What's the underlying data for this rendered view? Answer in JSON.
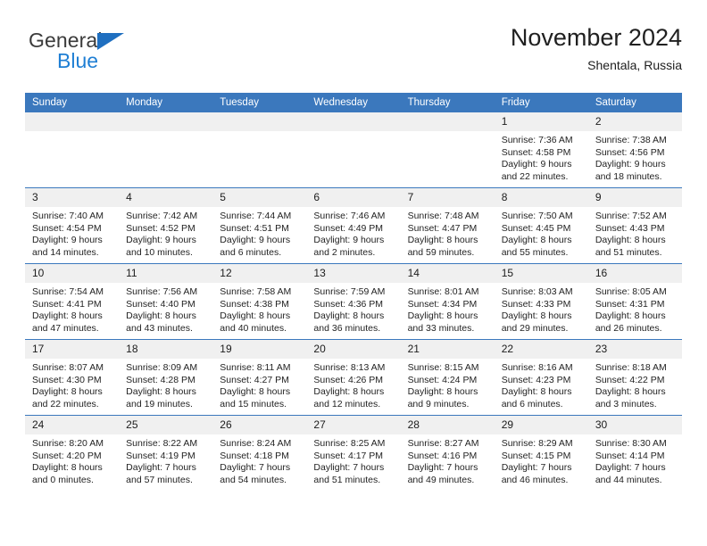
{
  "brand": {
    "name_top": "General",
    "name_bottom": "Blue",
    "triangle_color": "#1f6fc0",
    "blue_text_color": "#1f7fd4"
  },
  "header": {
    "title": "November 2024",
    "subtitle": "Shentala, Russia"
  },
  "theme": {
    "header_blue": "#3b78bd",
    "daynum_band": "#f0f0f0",
    "text": "#232323"
  },
  "weekday_headers": [
    "Sunday",
    "Monday",
    "Tuesday",
    "Wednesday",
    "Thursday",
    "Friday",
    "Saturday"
  ],
  "weeks": [
    [
      {
        "day": "",
        "empty": true,
        "sunrise": "",
        "sunset": "",
        "daylight_line1": "",
        "daylight_line2": ""
      },
      {
        "day": "",
        "empty": true,
        "sunrise": "",
        "sunset": "",
        "daylight_line1": "",
        "daylight_line2": ""
      },
      {
        "day": "",
        "empty": true,
        "sunrise": "",
        "sunset": "",
        "daylight_line1": "",
        "daylight_line2": ""
      },
      {
        "day": "",
        "empty": true,
        "sunrise": "",
        "sunset": "",
        "daylight_line1": "",
        "daylight_line2": ""
      },
      {
        "day": "",
        "empty": true,
        "sunrise": "",
        "sunset": "",
        "daylight_line1": "",
        "daylight_line2": ""
      },
      {
        "day": "1",
        "empty": false,
        "sunrise": "Sunrise: 7:36 AM",
        "sunset": "Sunset: 4:58 PM",
        "daylight_line1": "Daylight: 9 hours",
        "daylight_line2": "and 22 minutes."
      },
      {
        "day": "2",
        "empty": false,
        "sunrise": "Sunrise: 7:38 AM",
        "sunset": "Sunset: 4:56 PM",
        "daylight_line1": "Daylight: 9 hours",
        "daylight_line2": "and 18 minutes."
      }
    ],
    [
      {
        "day": "3",
        "empty": false,
        "sunrise": "Sunrise: 7:40 AM",
        "sunset": "Sunset: 4:54 PM",
        "daylight_line1": "Daylight: 9 hours",
        "daylight_line2": "and 14 minutes."
      },
      {
        "day": "4",
        "empty": false,
        "sunrise": "Sunrise: 7:42 AM",
        "sunset": "Sunset: 4:52 PM",
        "daylight_line1": "Daylight: 9 hours",
        "daylight_line2": "and 10 minutes."
      },
      {
        "day": "5",
        "empty": false,
        "sunrise": "Sunrise: 7:44 AM",
        "sunset": "Sunset: 4:51 PM",
        "daylight_line1": "Daylight: 9 hours",
        "daylight_line2": "and 6 minutes."
      },
      {
        "day": "6",
        "empty": false,
        "sunrise": "Sunrise: 7:46 AM",
        "sunset": "Sunset: 4:49 PM",
        "daylight_line1": "Daylight: 9 hours",
        "daylight_line2": "and 2 minutes."
      },
      {
        "day": "7",
        "empty": false,
        "sunrise": "Sunrise: 7:48 AM",
        "sunset": "Sunset: 4:47 PM",
        "daylight_line1": "Daylight: 8 hours",
        "daylight_line2": "and 59 minutes."
      },
      {
        "day": "8",
        "empty": false,
        "sunrise": "Sunrise: 7:50 AM",
        "sunset": "Sunset: 4:45 PM",
        "daylight_line1": "Daylight: 8 hours",
        "daylight_line2": "and 55 minutes."
      },
      {
        "day": "9",
        "empty": false,
        "sunrise": "Sunrise: 7:52 AM",
        "sunset": "Sunset: 4:43 PM",
        "daylight_line1": "Daylight: 8 hours",
        "daylight_line2": "and 51 minutes."
      }
    ],
    [
      {
        "day": "10",
        "empty": false,
        "sunrise": "Sunrise: 7:54 AM",
        "sunset": "Sunset: 4:41 PM",
        "daylight_line1": "Daylight: 8 hours",
        "daylight_line2": "and 47 minutes."
      },
      {
        "day": "11",
        "empty": false,
        "sunrise": "Sunrise: 7:56 AM",
        "sunset": "Sunset: 4:40 PM",
        "daylight_line1": "Daylight: 8 hours",
        "daylight_line2": "and 43 minutes."
      },
      {
        "day": "12",
        "empty": false,
        "sunrise": "Sunrise: 7:58 AM",
        "sunset": "Sunset: 4:38 PM",
        "daylight_line1": "Daylight: 8 hours",
        "daylight_line2": "and 40 minutes."
      },
      {
        "day": "13",
        "empty": false,
        "sunrise": "Sunrise: 7:59 AM",
        "sunset": "Sunset: 4:36 PM",
        "daylight_line1": "Daylight: 8 hours",
        "daylight_line2": "and 36 minutes."
      },
      {
        "day": "14",
        "empty": false,
        "sunrise": "Sunrise: 8:01 AM",
        "sunset": "Sunset: 4:34 PM",
        "daylight_line1": "Daylight: 8 hours",
        "daylight_line2": "and 33 minutes."
      },
      {
        "day": "15",
        "empty": false,
        "sunrise": "Sunrise: 8:03 AM",
        "sunset": "Sunset: 4:33 PM",
        "daylight_line1": "Daylight: 8 hours",
        "daylight_line2": "and 29 minutes."
      },
      {
        "day": "16",
        "empty": false,
        "sunrise": "Sunrise: 8:05 AM",
        "sunset": "Sunset: 4:31 PM",
        "daylight_line1": "Daylight: 8 hours",
        "daylight_line2": "and 26 minutes."
      }
    ],
    [
      {
        "day": "17",
        "empty": false,
        "sunrise": "Sunrise: 8:07 AM",
        "sunset": "Sunset: 4:30 PM",
        "daylight_line1": "Daylight: 8 hours",
        "daylight_line2": "and 22 minutes."
      },
      {
        "day": "18",
        "empty": false,
        "sunrise": "Sunrise: 8:09 AM",
        "sunset": "Sunset: 4:28 PM",
        "daylight_line1": "Daylight: 8 hours",
        "daylight_line2": "and 19 minutes."
      },
      {
        "day": "19",
        "empty": false,
        "sunrise": "Sunrise: 8:11 AM",
        "sunset": "Sunset: 4:27 PM",
        "daylight_line1": "Daylight: 8 hours",
        "daylight_line2": "and 15 minutes."
      },
      {
        "day": "20",
        "empty": false,
        "sunrise": "Sunrise: 8:13 AM",
        "sunset": "Sunset: 4:26 PM",
        "daylight_line1": "Daylight: 8 hours",
        "daylight_line2": "and 12 minutes."
      },
      {
        "day": "21",
        "empty": false,
        "sunrise": "Sunrise: 8:15 AM",
        "sunset": "Sunset: 4:24 PM",
        "daylight_line1": "Daylight: 8 hours",
        "daylight_line2": "and 9 minutes."
      },
      {
        "day": "22",
        "empty": false,
        "sunrise": "Sunrise: 8:16 AM",
        "sunset": "Sunset: 4:23 PM",
        "daylight_line1": "Daylight: 8 hours",
        "daylight_line2": "and 6 minutes."
      },
      {
        "day": "23",
        "empty": false,
        "sunrise": "Sunrise: 8:18 AM",
        "sunset": "Sunset: 4:22 PM",
        "daylight_line1": "Daylight: 8 hours",
        "daylight_line2": "and 3 minutes."
      }
    ],
    [
      {
        "day": "24",
        "empty": false,
        "sunrise": "Sunrise: 8:20 AM",
        "sunset": "Sunset: 4:20 PM",
        "daylight_line1": "Daylight: 8 hours",
        "daylight_line2": "and 0 minutes."
      },
      {
        "day": "25",
        "empty": false,
        "sunrise": "Sunrise: 8:22 AM",
        "sunset": "Sunset: 4:19 PM",
        "daylight_line1": "Daylight: 7 hours",
        "daylight_line2": "and 57 minutes."
      },
      {
        "day": "26",
        "empty": false,
        "sunrise": "Sunrise: 8:24 AM",
        "sunset": "Sunset: 4:18 PM",
        "daylight_line1": "Daylight: 7 hours",
        "daylight_line2": "and 54 minutes."
      },
      {
        "day": "27",
        "empty": false,
        "sunrise": "Sunrise: 8:25 AM",
        "sunset": "Sunset: 4:17 PM",
        "daylight_line1": "Daylight: 7 hours",
        "daylight_line2": "and 51 minutes."
      },
      {
        "day": "28",
        "empty": false,
        "sunrise": "Sunrise: 8:27 AM",
        "sunset": "Sunset: 4:16 PM",
        "daylight_line1": "Daylight: 7 hours",
        "daylight_line2": "and 49 minutes."
      },
      {
        "day": "29",
        "empty": false,
        "sunrise": "Sunrise: 8:29 AM",
        "sunset": "Sunset: 4:15 PM",
        "daylight_line1": "Daylight: 7 hours",
        "daylight_line2": "and 46 minutes."
      },
      {
        "day": "30",
        "empty": false,
        "sunrise": "Sunrise: 8:30 AM",
        "sunset": "Sunset: 4:14 PM",
        "daylight_line1": "Daylight: 7 hours",
        "daylight_line2": "and 44 minutes."
      }
    ]
  ]
}
